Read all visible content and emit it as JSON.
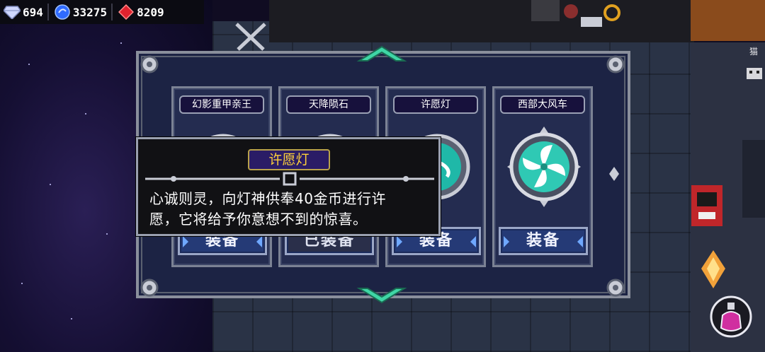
{
  "currency": {
    "gems": {
      "value": "694",
      "icon": "diamond-icon",
      "color": "#cfd8ff"
    },
    "energy": {
      "value": "33275",
      "icon": "blue-orb-icon",
      "color": "#2f6bff"
    },
    "rubies": {
      "value": "8209",
      "icon": "ruby-icon",
      "color": "#e0222e"
    }
  },
  "skins": [
    {
      "name": "幻影重甲亲王",
      "button": "装备",
      "equipped": false,
      "medal_icon": "dragon-medal-icon"
    },
    {
      "name": "天降陨石",
      "button": "已装备",
      "equipped": true,
      "medal_icon": "serpent-medal-icon"
    },
    {
      "name": "许愿灯",
      "button": "装备",
      "equipped": false,
      "medal_icon": "wave-medal-icon"
    },
    {
      "name": "西部大风车",
      "button": "装备",
      "equipped": false,
      "medal_icon": "pinwheel-medal-icon"
    }
  ],
  "tooltip": {
    "title": "许愿灯",
    "description_line1": "心诚则灵，向灯神供奉40金币进行许",
    "description_line2": "愿，它将给予你意想不到的惊喜。"
  },
  "side_label": "猫"
}
